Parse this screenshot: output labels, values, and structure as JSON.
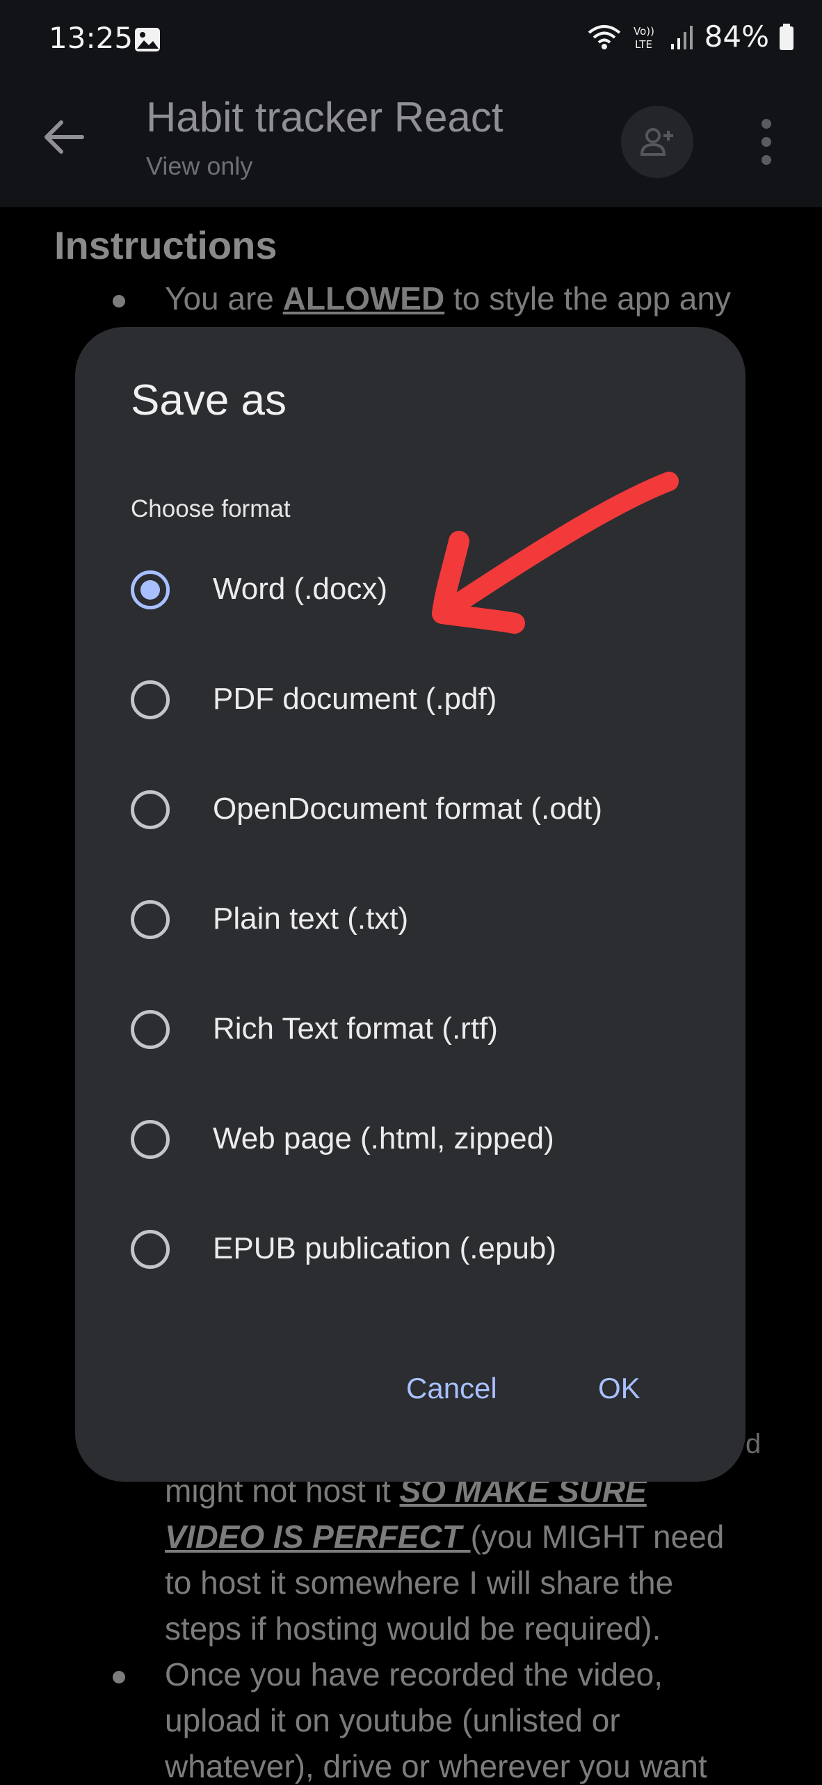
{
  "status_bar": {
    "time": "13:25",
    "battery": "84%",
    "icons": [
      "image-icon",
      "wifi-icon",
      "volte-icon",
      "signal-icon",
      "battery-icon"
    ],
    "volte_label": "Vo)) LTE"
  },
  "app_bar": {
    "title": "Habit tracker React",
    "subtitle": "View only",
    "back_icon": "arrow-left-icon",
    "share_icon": "add-person-icon",
    "menu_icon": "more-vert-icon"
  },
  "document": {
    "heading": "Instructions",
    "line1_pre": "You are ",
    "line1_bold": "ALLOWED",
    "line1_post": " to style the app any",
    "partial_right_fragment": "d",
    "line2_pre": "might not host it ",
    "line2_emph": "SO MAKE SURE",
    "line3_emph": "VIDEO IS PERFECT ",
    "line3_post": "(you MIGHT need",
    "line4": "to host it somewhere I will share the",
    "line5": "steps if hosting would be required).",
    "line6": "Once you have recorded the video,",
    "line7": "upload it on youtube (unlisted or",
    "line8": "whatever), drive or wherever you want"
  },
  "dialog": {
    "title": "Save as",
    "subtitle": "Choose format",
    "options": [
      {
        "label": "Word (.docx)",
        "selected": true
      },
      {
        "label": "PDF document (.pdf)",
        "selected": false
      },
      {
        "label": "OpenDocument format (.odt)",
        "selected": false
      },
      {
        "label": "Plain text (.txt)",
        "selected": false
      },
      {
        "label": "Rich Text format (.rtf)",
        "selected": false
      },
      {
        "label": "Web page (.html, zipped)",
        "selected": false
      },
      {
        "label": "EPUB publication (.epub)",
        "selected": false
      }
    ],
    "cancel_label": "Cancel",
    "ok_label": "OK",
    "accent_color": "#a8c0ff"
  },
  "annotation": {
    "color": "#f23a3a",
    "icon": "red-arrow-annotation"
  }
}
